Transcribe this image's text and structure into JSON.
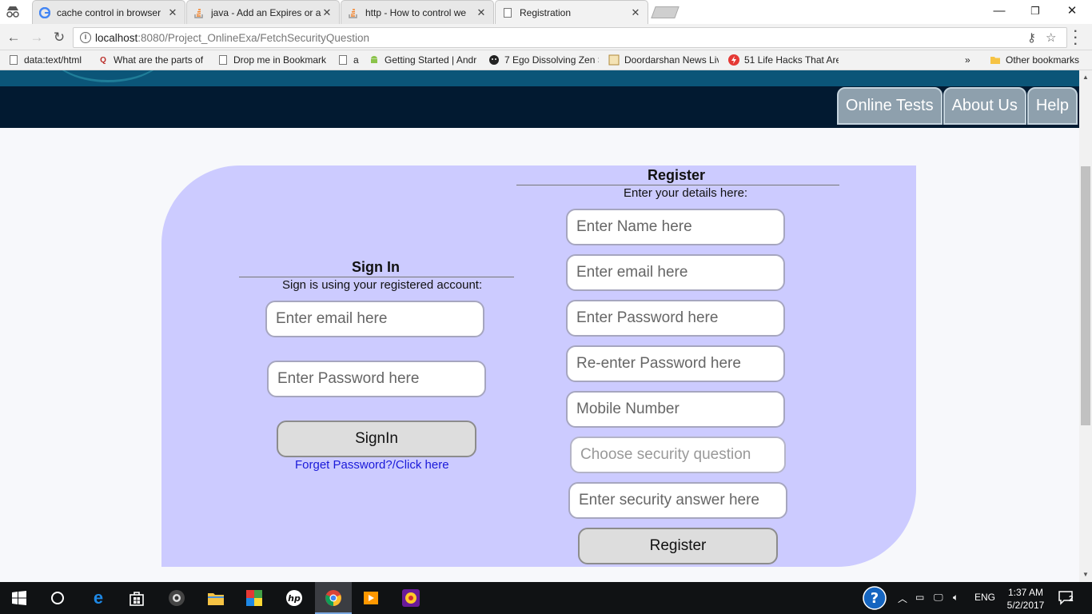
{
  "browser": {
    "tabs": [
      {
        "label": "cache control in browser"
      },
      {
        "label": "java - Add an Expires or a"
      },
      {
        "label": "http - How to control we"
      },
      {
        "label": "Registration"
      }
    ],
    "url_host": "localhost",
    "url_path": ":8080/Project_OnlineExa/FetchSecurityQuestion",
    "bookmarks": [
      "data:text/html",
      "What are the parts of",
      "Drop me in Bookmark",
      "a",
      "Getting Started | Andr",
      "7 Ego Dissolving Zen S",
      "Doordarshan News Liv",
      "51 Life Hacks That Are"
    ],
    "bookmarks_overflow": "»",
    "other_bookmarks": "Other bookmarks"
  },
  "nav": {
    "links": [
      "Online Tests",
      "About Us",
      "Help"
    ]
  },
  "signin": {
    "title": "Sign In",
    "subtitle": "Sign is using your registered account:",
    "email_placeholder": "Enter email here",
    "password_placeholder": "Enter Password here",
    "button": "SignIn",
    "forgot_link": "Forget Password?/Click here"
  },
  "register": {
    "title": "Register",
    "subtitle": "Enter your details here:",
    "name_placeholder": "Enter Name here",
    "email_placeholder": "Enter email here",
    "password_placeholder": "Enter Password here",
    "repassword_placeholder": "Re-enter Password here",
    "mobile_placeholder": "Mobile Number",
    "security_question_placeholder": "Choose security question",
    "security_answer_placeholder": "Enter security answer here",
    "button": "Register"
  },
  "taskbar": {
    "lang": "ENG",
    "time": "1:37 AM",
    "date": "5/2/2017",
    "notifications": "2"
  },
  "colors": {
    "card_bg": "#cccbff",
    "banner_bg": "#021a31",
    "link": "#1a1ad9"
  }
}
